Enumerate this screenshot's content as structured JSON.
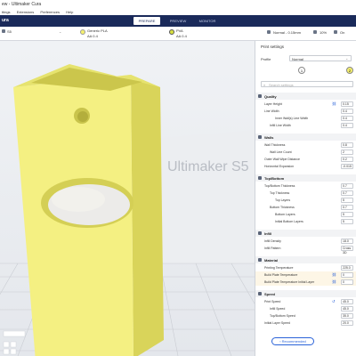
{
  "window": {
    "title": "ew - Ultimaker Cura"
  },
  "menu": {
    "items": [
      "ttings",
      "Extensions",
      "Preferences",
      "Help"
    ]
  },
  "app": {
    "name": "ura",
    "stages": [
      "PREPARE",
      "PREVIEW",
      "MONITOR"
    ],
    "active_stage": "PREPARE"
  },
  "jobbar": {
    "printer": "S5",
    "core_primary": "AA 0.4",
    "material_primary": "Generic PLA",
    "core_secondary": "AA 0.4",
    "material_secondary": "PVA",
    "profile": "Normal - 0.15mm",
    "support": "10%",
    "adhesion": "On",
    "colors": {
      "primary": "#f5f06e",
      "secondary": "#d8e040",
      "accent": "#1a2a5a",
      "link": "#2a62d8"
    }
  },
  "viewport": {
    "build_plate_label": "Ultimaker S5",
    "object_color": "#f4f082"
  },
  "panel": {
    "title": "Print settings",
    "profile_label": "Profile",
    "profile_value": "Normal",
    "extruder_1": "1",
    "extruder_2": "2",
    "search_placeholder": "Search settings",
    "sections": [
      {
        "title": "Quality",
        "rows": [
          {
            "label": "Layer Height",
            "value": "0.15",
            "indent": 0
          },
          {
            "label": "Line Width",
            "value": "0.4",
            "indent": 0
          },
          {
            "label": "Inner Wall(s) Line Width",
            "value": "0.4",
            "indent": 2
          },
          {
            "label": "Infill Line Width",
            "value": "0.4",
            "indent": 1
          }
        ]
      },
      {
        "title": "Walls",
        "rows": [
          {
            "label": "Wall Thickness",
            "value": "0.8",
            "indent": 0
          },
          {
            "label": "Wall Line Count",
            "value": "2",
            "indent": 1
          },
          {
            "label": "Outer Wall Wipe Distance",
            "value": "0.2",
            "indent": 0
          },
          {
            "label": "Horizontal Expansion",
            "value": "-0.015",
            "indent": 0
          }
        ]
      },
      {
        "title": "Top/Bottom",
        "rows": [
          {
            "label": "Top/Bottom Thickness",
            "value": "0.7",
            "indent": 0
          },
          {
            "label": "Top Thickness",
            "value": "0.7",
            "indent": 1
          },
          {
            "label": "Top Layers",
            "value": "5",
            "indent": 2
          },
          {
            "label": "Bottom Thickness",
            "value": "0.7",
            "indent": 1
          },
          {
            "label": "Bottom Layers",
            "value": "5",
            "indent": 2
          },
          {
            "label": "Initial Bottom Layers",
            "value": "5",
            "indent": 2
          }
        ]
      },
      {
        "title": "Infill",
        "rows": [
          {
            "label": "Infill Density",
            "value": "18.0",
            "indent": 0
          },
          {
            "label": "Infill Pattern",
            "value": "Cross 3D",
            "indent": 0
          }
        ]
      },
      {
        "title": "Material",
        "rows": [
          {
            "label": "Printing Temperature",
            "value": "225.0",
            "indent": 0
          },
          {
            "label": "Build Plate Temperature",
            "value": "0",
            "indent": 0
          },
          {
            "label": "Build Plate Temperature Initial Layer",
            "value": "0",
            "indent": 0
          }
        ]
      },
      {
        "title": "Speed",
        "rows": [
          {
            "label": "Print Speed",
            "value": "45.0",
            "indent": 0
          },
          {
            "label": "Infill Speed",
            "value": "45.0",
            "indent": 1
          },
          {
            "label": "Top/Bottom Speed",
            "value": "35.0",
            "indent": 1
          },
          {
            "label": "Initial Layer Speed",
            "value": "20.0",
            "indent": 0
          }
        ]
      }
    ],
    "recommended_button": "Recommended"
  }
}
